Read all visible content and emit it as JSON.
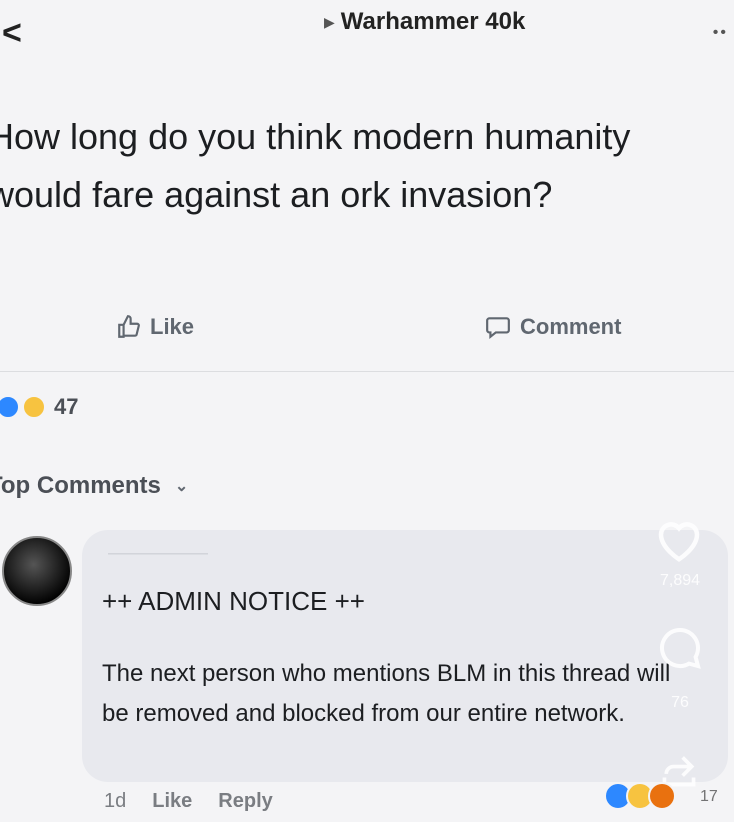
{
  "header": {
    "page_name": "Warhammer 40k"
  },
  "post": {
    "text": "How long do you think modern humanity would fare against an ork invasion?",
    "actions": {
      "like": "Like",
      "comment": "Comment"
    },
    "reactions_count": "47"
  },
  "comments_section": {
    "title": "Top Comments",
    "comment": {
      "notice": "++ ADMIN NOTICE ++",
      "body": "The next person who mentions BLM in this thread will be removed and blocked from our entire network.",
      "time": "1d",
      "like": "Like",
      "reply": "Reply"
    }
  },
  "overlay": {
    "likes": "7,894",
    "comments": "76",
    "shares": "17"
  },
  "colors": {
    "background": "#f4f4f6",
    "bubble": "#e8e9ee",
    "like_blue": "#2d88ff",
    "haha_yellow": "#f7c340"
  }
}
